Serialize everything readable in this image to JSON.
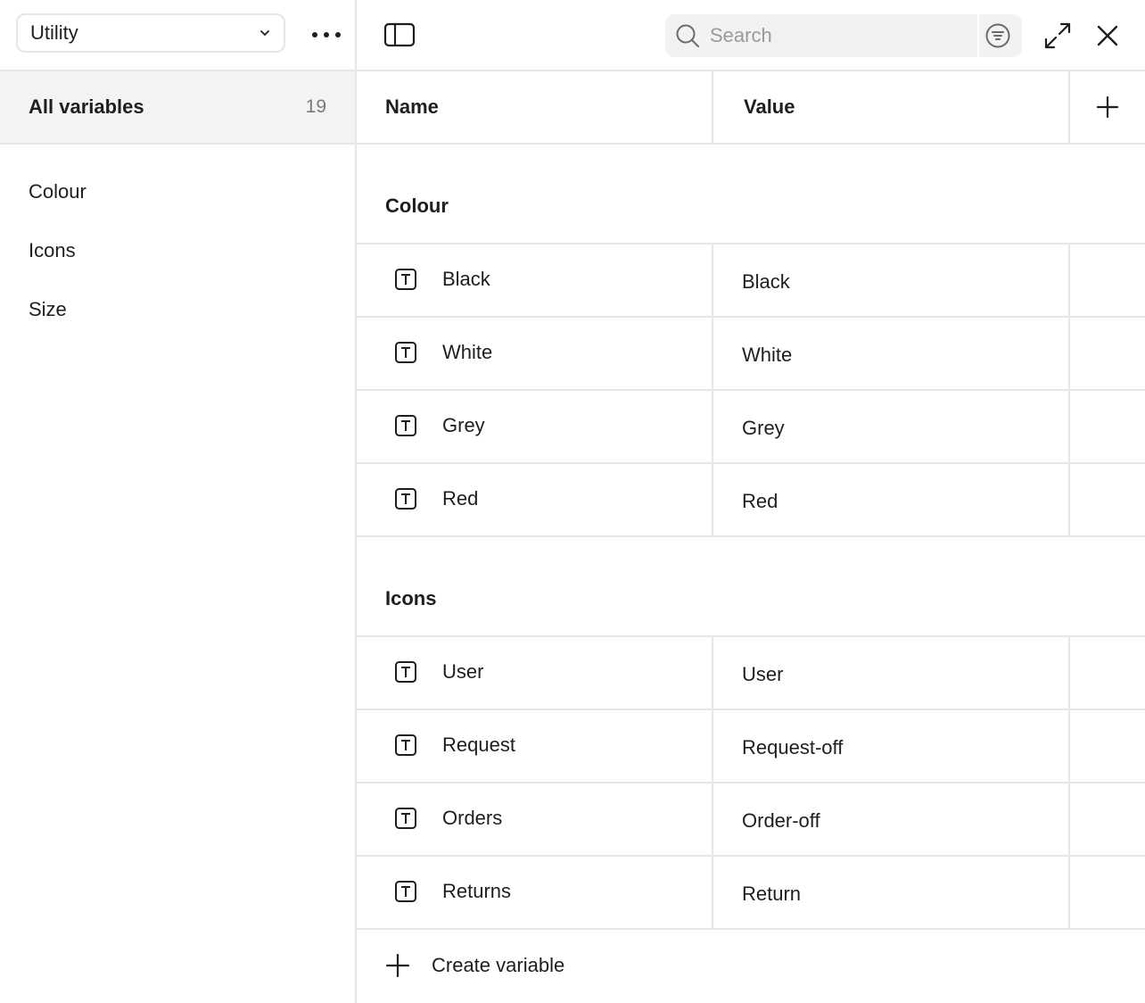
{
  "sidebar": {
    "collection_select": {
      "value": "Utility",
      "icon": "chevron-down-icon"
    },
    "more_icon": "ellipsis-icon",
    "all_variables": {
      "label": "All variables",
      "count": "19"
    },
    "groups": [
      {
        "label": "Colour"
      },
      {
        "label": "Icons"
      },
      {
        "label": "Size"
      }
    ]
  },
  "toolbar": {
    "panel_toggle_icon": "sidebar-panel-icon",
    "search": {
      "placeholder": "Search",
      "value": ""
    },
    "filter_icon": "filter-icon",
    "expand_icon": "expand-icon",
    "close_icon": "close-icon"
  },
  "table": {
    "columns": {
      "name": "Name",
      "value": "Value"
    },
    "add_icon": "plus-icon",
    "sections": [
      {
        "title": "Colour",
        "rows": [
          {
            "name": "Black",
            "value": "Black",
            "type_icon": "text-type-icon"
          },
          {
            "name": "White",
            "value": "White",
            "type_icon": "text-type-icon"
          },
          {
            "name": "Grey",
            "value": "Grey",
            "type_icon": "text-type-icon"
          },
          {
            "name": "Red",
            "value": "Red",
            "type_icon": "text-type-icon"
          }
        ]
      },
      {
        "title": "Icons",
        "rows": [
          {
            "name": "User",
            "value": "User",
            "type_icon": "text-type-icon"
          },
          {
            "name": "Request",
            "value": "Request-off",
            "type_icon": "text-type-icon"
          },
          {
            "name": "Orders",
            "value": "Order-off",
            "type_icon": "text-type-icon"
          },
          {
            "name": "Returns",
            "value": "Return",
            "type_icon": "text-type-icon"
          }
        ]
      }
    ],
    "create_label": "Create variable"
  },
  "colors": {
    "text": "#1e1e1e",
    "muted": "#7a7a7a",
    "border": "#e6e6e6",
    "selected_bg": "#f3f3f3",
    "search_bg": "#f2f2f2"
  }
}
